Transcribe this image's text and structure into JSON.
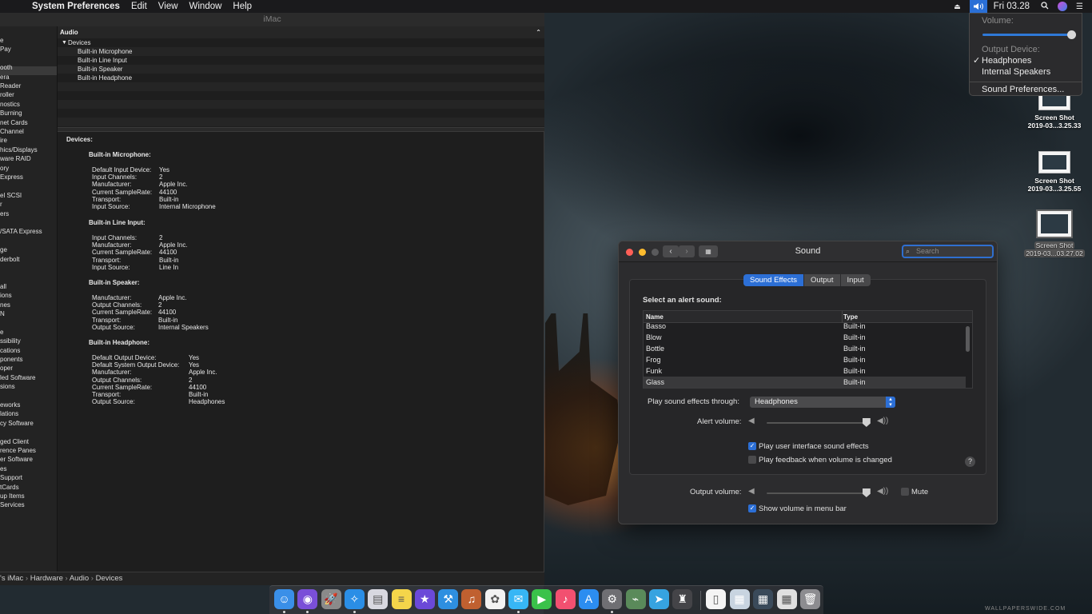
{
  "menubar": {
    "app_name": "System Preferences",
    "menus": [
      "Edit",
      "View",
      "Window",
      "Help"
    ],
    "clock": "Fri 03.28"
  },
  "volume_menu": {
    "volume_label": "Volume:",
    "volume_level": 0.96,
    "output_device_label": "Output Device:",
    "options": [
      "Headphones",
      "Internal Speakers"
    ],
    "selected_option": "Headphones",
    "preferences_label": "Sound Preferences..."
  },
  "sysinfo": {
    "title": "iMac",
    "sidebar": [
      "e",
      "Pay",
      "",
      "ooth",
      "era",
      "Reader",
      "roller",
      "nostics",
      "Burning",
      "net Cards",
      "Channel",
      "ire",
      "hics/Displays",
      "ware RAID",
      "ory",
      "Express",
      "",
      "el SCSI",
      "r",
      "ers",
      "",
      "/SATA Express",
      "",
      "ge",
      "derbolt",
      "",
      "",
      "all",
      "ions",
      "nes",
      "N",
      "",
      "e",
      "ssibility",
      "cations",
      "ponents",
      "oper",
      "led Software",
      "sions",
      "",
      "eworks",
      "lations",
      "cy Software",
      "",
      "ged Client",
      "rence Panes",
      "er Software",
      "es",
      "Support",
      "tCards",
      "up Items",
      "Services"
    ],
    "list_header": "Audio",
    "group": "Devices",
    "devices": [
      "Built-in Microphone",
      "Built-in Line Input",
      "Built-in Speaker",
      "Built-in Headphone"
    ],
    "detail_title": "Devices:",
    "sections": [
      {
        "name": "Built-in Microphone:",
        "props": [
          [
            "Default Input Device:",
            "Yes"
          ],
          [
            "Input Channels:",
            "2"
          ],
          [
            "Manufacturer:",
            "Apple Inc."
          ],
          [
            "Current SampleRate:",
            "44100"
          ],
          [
            "Transport:",
            "Built-in"
          ],
          [
            "Input Source:",
            "Internal Microphone"
          ]
        ]
      },
      {
        "name": "Built-in Line Input:",
        "props": [
          [
            "Input Channels:",
            "2"
          ],
          [
            "Manufacturer:",
            "Apple Inc."
          ],
          [
            "Current SampleRate:",
            "44100"
          ],
          [
            "Transport:",
            "Built-in"
          ],
          [
            "Input Source:",
            "Line In"
          ]
        ]
      },
      {
        "name": "Built-in Speaker:",
        "props": [
          [
            "Manufacturer:",
            "Apple Inc."
          ],
          [
            "Output Channels:",
            "2"
          ],
          [
            "Current SampleRate:",
            "44100"
          ],
          [
            "Transport:",
            "Built-in"
          ],
          [
            "Output Source:",
            "Internal Speakers"
          ]
        ]
      },
      {
        "name": "Built-in Headphone:",
        "props": [
          [
            "Default Output Device:",
            "Yes"
          ],
          [
            "Default System Output Device:",
            "Yes"
          ],
          [
            "Manufacturer:",
            "Apple Inc."
          ],
          [
            "Output Channels:",
            "2"
          ],
          [
            "Current SampleRate:",
            "44100"
          ],
          [
            "Transport:",
            "Built-in"
          ],
          [
            "Output Source:",
            "Headphones"
          ]
        ]
      }
    ],
    "path": [
      "'s iMac",
      "Hardware",
      "Audio",
      "Devices"
    ]
  },
  "desktop_icons": [
    {
      "line1": "Screen Shot",
      "line2": "2019-03...3.25.33"
    },
    {
      "line1": "Screen Shot",
      "line2": "2019-03...3.25.55"
    },
    {
      "line1": "Screen Shot",
      "line2": "2019-03...03.27.02"
    }
  ],
  "sound": {
    "title": "Sound",
    "search_placeholder": "Search",
    "tabs": [
      "Sound Effects",
      "Output",
      "Input"
    ],
    "active_tab": "Sound Effects",
    "select_label": "Select an alert sound:",
    "columns": [
      "Name",
      "Type"
    ],
    "alerts": [
      {
        "name": "Basso",
        "type": "Built-in"
      },
      {
        "name": "Blow",
        "type": "Built-in"
      },
      {
        "name": "Bottle",
        "type": "Built-in"
      },
      {
        "name": "Frog",
        "type": "Built-in"
      },
      {
        "name": "Funk",
        "type": "Built-in"
      },
      {
        "name": "Glass",
        "type": "Built-in"
      }
    ],
    "selected_alert": "Glass",
    "play_through_label": "Play sound effects through:",
    "play_through_value": "Headphones",
    "alert_volume_label": "Alert volume:",
    "alert_volume": 0.96,
    "play_ui_label": "Play user interface sound effects",
    "play_ui_checked": true,
    "feedback_label": "Play feedback when volume is changed",
    "feedback_checked": false,
    "output_volume_label": "Output volume:",
    "output_volume": 0.96,
    "mute_label": "Mute",
    "mute_checked": false,
    "show_volume_label": "Show volume in menu bar",
    "show_volume_checked": true
  },
  "dock": {
    "apps": [
      {
        "name": "finder-icon",
        "color": "#3a8fe8"
      },
      {
        "name": "siri-icon",
        "color": "#7a4fd8"
      },
      {
        "name": "launchpad-icon",
        "color": "#8a8a8a"
      },
      {
        "name": "safari-icon",
        "color": "#2a8ee6"
      },
      {
        "name": "preview-icon",
        "color": "#d8d8e0"
      },
      {
        "name": "notes-icon",
        "color": "#f4d54a"
      },
      {
        "name": "imovie-icon",
        "color": "#6b49d8"
      },
      {
        "name": "xcode-icon",
        "color": "#2e8fe0"
      },
      {
        "name": "garageband-icon",
        "color": "#c06030"
      },
      {
        "name": "photos-icon",
        "color": "#f2f2f2"
      },
      {
        "name": "messages-icon",
        "color": "#37b6f5"
      },
      {
        "name": "facetime-icon",
        "color": "#3ac24a"
      },
      {
        "name": "music-icon",
        "color": "#f25070"
      },
      {
        "name": "app-store-icon",
        "color": "#2c8df0"
      },
      {
        "name": "system-preferences-icon",
        "color": "#6f6f73"
      },
      {
        "name": "network-utility-icon",
        "color": "#5a8a5a"
      },
      {
        "name": "telegram-icon",
        "color": "#36a3e0"
      },
      {
        "name": "automator-icon",
        "color": "#444448"
      },
      {
        "name": "document-icon",
        "color": "#f4f4f4"
      },
      {
        "name": "window-thumbnail-icon",
        "color": "#c8d4e0"
      },
      {
        "name": "window-thumbnail-icon-2",
        "color": "#3a4a5a"
      },
      {
        "name": "window-thumbnail-icon-3",
        "color": "#e0e0e0"
      },
      {
        "name": "trash-icon",
        "color": "#8c8c90"
      }
    ],
    "running": [
      0,
      1,
      3,
      10,
      14
    ]
  },
  "watermark": "WALLPAPERSWIDE.COM"
}
